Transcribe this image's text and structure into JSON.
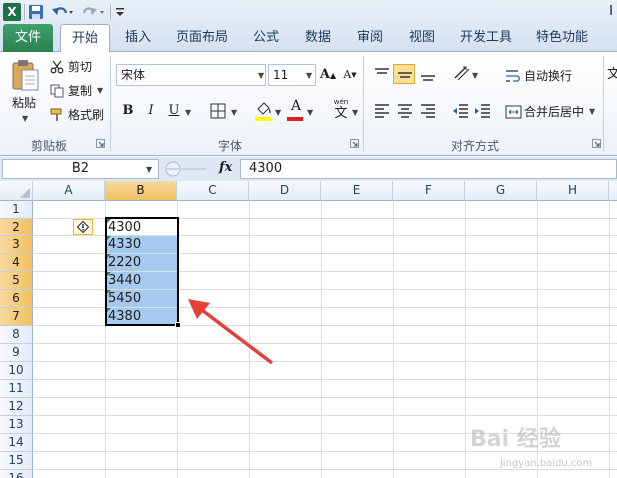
{
  "app": {
    "logo": "X",
    "title_fragment": "I",
    "colors": {
      "file_tab": "#2a8050",
      "selection": "#a6caef",
      "selected_header": "#f1c15f",
      "arrow": "#e5403a"
    }
  },
  "tabs": [
    "文件",
    "开始",
    "插入",
    "页面布局",
    "公式",
    "数据",
    "审阅",
    "视图",
    "开发工具",
    "特色功能"
  ],
  "clipboard": {
    "paste": "粘贴",
    "cut": "剪切",
    "copy": "复制",
    "format_painter": "格式刷",
    "group_label": "剪贴板"
  },
  "font": {
    "family": "宋体",
    "size": "11",
    "bold": "B",
    "italic": "I",
    "underline": "U",
    "font_color_glyph": "A",
    "wen_glyph": "文",
    "group_label": "字体"
  },
  "alignment": {
    "wrap_text": "自动换行",
    "merge_center": "合并后居中",
    "group_label": "对齐方式",
    "next_group_glyph": "文"
  },
  "formula_bar": {
    "name_box": "B2",
    "fx": "fx",
    "value": "4300"
  },
  "columns": [
    "A",
    "B",
    "C",
    "D",
    "E",
    "F",
    "G",
    "H"
  ],
  "rows": [
    "1",
    "2",
    "3",
    "4",
    "5",
    "6",
    "7",
    "8",
    "9",
    "10",
    "11",
    "12",
    "13",
    "14",
    "15",
    "16"
  ],
  "cells": {
    "B2": "4300",
    "B3": "4330",
    "B4": "2220",
    "B5": "3440",
    "B6": "5450",
    "B7": "4380"
  },
  "watermark": {
    "text": "Bai 经验",
    "url": "jingyan.baidu.com"
  }
}
